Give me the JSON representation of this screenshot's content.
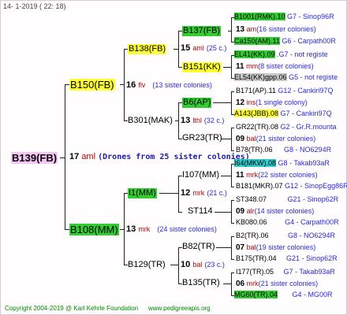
{
  "header": {
    "date": "14-  1-2019 (  22: 18)"
  },
  "root": {
    "name": "B139(FB)"
  },
  "level1": {
    "num": "17",
    "type": "aml",
    "note": "(Drones from 25 sister colonies)"
  },
  "p_top": {
    "name": "B150(FB)",
    "num": "16",
    "type": "flv",
    "note": "(13 sister colonies)"
  },
  "p_bot": {
    "name": "B108(MM)",
    "num": "13",
    "type": "mrk",
    "note": "(24 sister colonies)"
  },
  "g1": {
    "name": "B138(FB)",
    "num": "15",
    "type": "aml",
    "note": "(25 c.)"
  },
  "g2": {
    "name": "B301(MAK)",
    "num": "13",
    "type": "lthl",
    "note": "(32 c.)"
  },
  "g3": {
    "name": "I1(MM)",
    "num": "12",
    "type": "mrk",
    "note": "(21 c.)"
  },
  "g4": {
    "name": "B129(TR)",
    "num": "10",
    "type": "bal",
    "note": "(23 c.)"
  },
  "gg": [
    {
      "name": "B137(FB)"
    },
    {
      "name": "B151(KK)"
    },
    {
      "name": "B6(AP)"
    },
    {
      "name": "GR23(TR)"
    },
    {
      "name": "I107(MM)"
    },
    {
      "name": "ST114"
    },
    {
      "name": "B82(TR)"
    },
    {
      "name": "B135(TR)"
    }
  ],
  "ggg": [
    {
      "top": "B1001(RMK).10",
      "top_code": "G7 - Sinop96R",
      "mid_num": "13",
      "mid_type": "am",
      "mid_note": "(16 sister colonies)",
      "bot": "Ca150(AM).11",
      "bot_code": "G6 - Carpath00R"
    },
    {
      "top": "EL41(KK).09",
      "top_code": ".G7 - not registe",
      "mid_num": "11",
      "mid_type": "mm",
      "mid_note": "(8 sister colonies)",
      "bot": "EL54(KK)gpp.06",
      "bot_code": "G5 - not registe"
    },
    {
      "top": "B171(AP).11",
      "top_code": "G12 - Cankiri97Q",
      "mid_num": "12",
      "mid_type": "ins",
      "mid_note": "(1 single colony)",
      "bot": "A143(JBB).08",
      "bot_code": "G7 - Cankiri97Q"
    },
    {
      "top": "GR22(TR).08",
      "top_code": "G2 - Gr.R.mounta",
      "mid_num": "09",
      "mid_type": "bal",
      "mid_note": "(21 sister colonies)",
      "bot": "B78(TR).06",
      "bot_code": "G8 - NO6294R"
    },
    {
      "top": "I64(MKW).08",
      "top_code": "G8 - Takab93aR",
      "mid_num": "11",
      "mid_type": "mrk",
      "mid_note": "(22 sister colonies)",
      "bot": "B181(MKR).07",
      "bot_code": "G12 - SinopEgg86R"
    },
    {
      "top": "ST348.07",
      "top_code": "G21 - Sinop62R",
      "mid_num": "09",
      "mid_type": "alr",
      "mid_note": "(14 sister colonies)",
      "bot": "KB080.06",
      "bot_code": "G4 - Carpath00R"
    },
    {
      "top": "B2(TR).06",
      "top_code": "G8 - NO6294R",
      "mid_num": "07",
      "mid_type": "bal",
      "mid_note": "(19 sister colonies)",
      "bot": "B175(TR).04",
      "bot_code": "G21 - Sinop62R"
    },
    {
      "top": "I177(TR).05",
      "top_code": "G7 - Takab93aR",
      "mid_num": "06",
      "mid_type": "mrk",
      "mid_note": "(21 sister colonies)",
      "bot": "MG60(TR).04",
      "bot_code": "G4 - MG00R"
    }
  ],
  "footer": {
    "copyright": "Copyright 2004-2019 @ Karl Kehrle Foundation",
    "url": "www.pedigreeapis.org"
  }
}
